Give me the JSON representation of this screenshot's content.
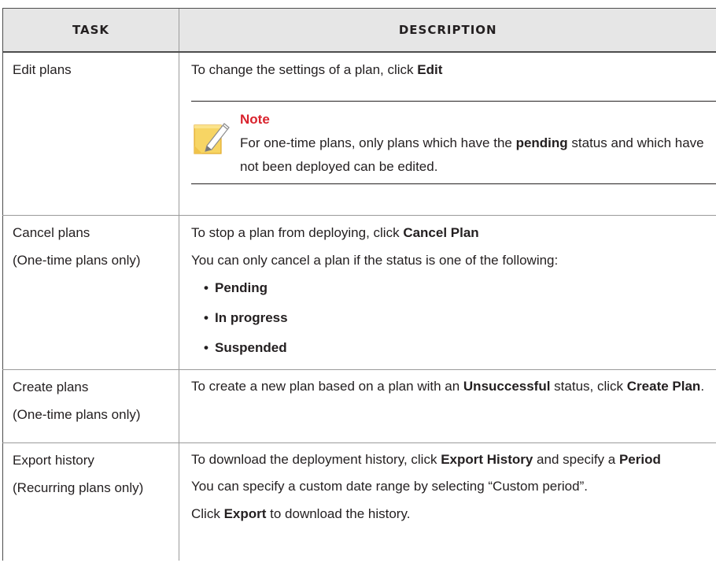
{
  "headers": {
    "task": "Task",
    "description": "Description"
  },
  "rows": [
    {
      "task": "Edit plans",
      "desc_pre": "To change the settings of a plan, click ",
      "desc_bold": "Edit",
      "note": {
        "title": "Note",
        "text_pre": "For one-time plans, only plans which have the ",
        "text_bold": "pending",
        "text_post": " status and which have not been deployed can be edited.",
        "icon": "note-pencil-icon"
      }
    },
    {
      "task": "Cancel plans",
      "task_sub": "(One-time plans only)",
      "desc_pre": "To stop a plan from deploying, click ",
      "desc_bold": "Cancel Plan",
      "desc2": "You can only cancel a plan if the status is one of the following:",
      "bullets": [
        "Pending",
        "In progress",
        "Suspended"
      ]
    },
    {
      "task": "Create plans",
      "task_sub": "(One-time plans only)",
      "desc_pre": "To create a new plan based on a plan with an ",
      "desc_bold": "Unsuccessful",
      "desc_mid": " status, click ",
      "desc_bold2": "Create Plan",
      "desc_post": "."
    },
    {
      "task": "Export history",
      "task_sub": "(Recurring plans only)",
      "desc_pre": "To download the deployment history, click ",
      "desc_bold": "Export History",
      "desc_mid": " and specify a ",
      "desc_bold2": "Period",
      "desc2": "You can specify a custom date range by selecting “Custom period”.",
      "desc3_pre": "Click ",
      "desc3_bold": "Export",
      "desc3_post": " to download the history."
    }
  ],
  "bullet_char": "•"
}
